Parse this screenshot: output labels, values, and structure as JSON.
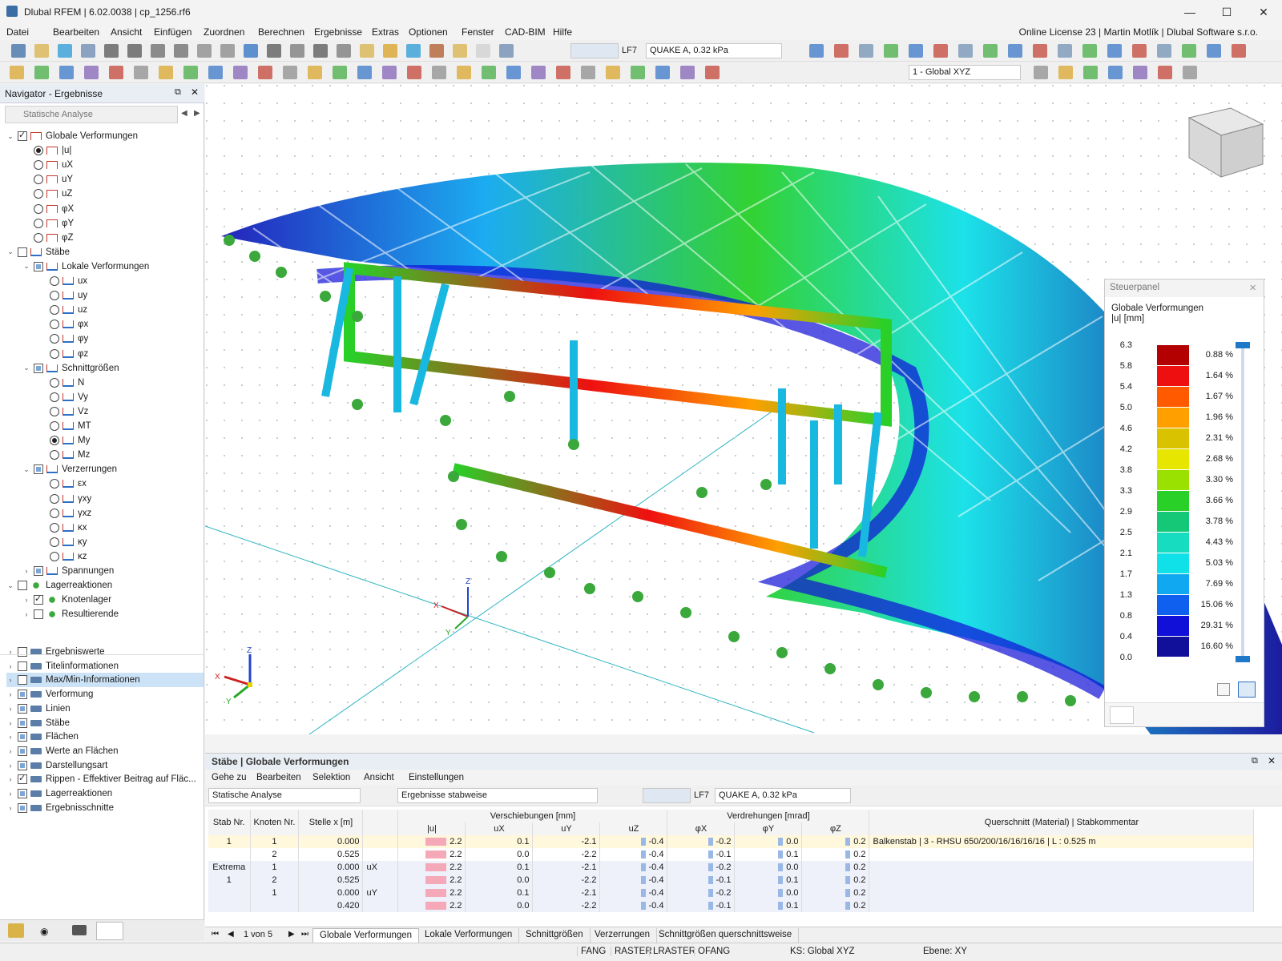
{
  "window": {
    "title": "Dlubal RFEM | 6.02.0038 | cp_1256.rf6",
    "license": "Online License 23 | Martin Motlík | Dlubal Software s.r.o."
  },
  "menu": [
    "Datei",
    "Bearbeiten",
    "Ansicht",
    "Einfügen",
    "Zuordnen",
    "Berechnen",
    "Ergebnisse",
    "Extras",
    "Optionen",
    "Fenster",
    "CAD-BIM",
    "Hilfe"
  ],
  "toolbar": {
    "load_case": "LF7",
    "load_case_name": "QUAKE A, 0.32 kPa",
    "coord_system": "1 - Global XYZ"
  },
  "navigator": {
    "title": "Navigator - Ergebnisse",
    "analysis": "Statische Analyse",
    "tree": [
      {
        "label": "Globale Verformungen",
        "type": "cb",
        "state": "on",
        "depth": 0,
        "exp": "v",
        "icon": "def"
      },
      {
        "label": "|u|",
        "type": "rb",
        "state": "on",
        "depth": 1,
        "icon": "def"
      },
      {
        "label": "uX",
        "type": "rb",
        "depth": 1,
        "icon": "def"
      },
      {
        "label": "uY",
        "type": "rb",
        "depth": 1,
        "icon": "def"
      },
      {
        "label": "uZ",
        "type": "rb",
        "depth": 1,
        "icon": "def"
      },
      {
        "label": "φX",
        "type": "rb",
        "depth": 1,
        "icon": "def"
      },
      {
        "label": "φY",
        "type": "rb",
        "depth": 1,
        "icon": "def"
      },
      {
        "label": "φZ",
        "type": "rb",
        "depth": 1,
        "icon": "def"
      },
      {
        "label": "Stäbe",
        "type": "cb",
        "depth": 0,
        "exp": "v",
        "icon": "mem"
      },
      {
        "label": "Lokale Verformungen",
        "type": "cb",
        "state": "part",
        "depth": 1,
        "exp": "v",
        "icon": "mem"
      },
      {
        "label": "ux",
        "type": "rb",
        "depth": 2,
        "icon": "mem"
      },
      {
        "label": "uy",
        "type": "rb",
        "depth": 2,
        "icon": "mem"
      },
      {
        "label": "uz",
        "type": "rb",
        "depth": 2,
        "icon": "mem"
      },
      {
        "label": "φx",
        "type": "rb",
        "depth": 2,
        "icon": "mem"
      },
      {
        "label": "φy",
        "type": "rb",
        "depth": 2,
        "icon": "mem"
      },
      {
        "label": "φz",
        "type": "rb",
        "depth": 2,
        "icon": "mem"
      },
      {
        "label": "Schnittgrößen",
        "type": "cb",
        "state": "part",
        "depth": 1,
        "exp": "v",
        "icon": "mem"
      },
      {
        "label": "N",
        "type": "rb",
        "depth": 2,
        "icon": "mem"
      },
      {
        "label": "Vy",
        "type": "rb",
        "depth": 2,
        "icon": "mem"
      },
      {
        "label": "Vz",
        "type": "rb",
        "depth": 2,
        "icon": "mem"
      },
      {
        "label": "MT",
        "type": "rb",
        "depth": 2,
        "icon": "mem"
      },
      {
        "label": "My",
        "type": "rb",
        "state": "on",
        "depth": 2,
        "icon": "mem"
      },
      {
        "label": "Mz",
        "type": "rb",
        "depth": 2,
        "icon": "mem"
      },
      {
        "label": "Verzerrungen",
        "type": "cb",
        "state": "part",
        "depth": 1,
        "exp": "v",
        "icon": "mem"
      },
      {
        "label": "εx",
        "type": "rb",
        "depth": 2,
        "icon": "mem"
      },
      {
        "label": "γxy",
        "type": "rb",
        "depth": 2,
        "icon": "mem"
      },
      {
        "label": "γxz",
        "type": "rb",
        "depth": 2,
        "icon": "mem"
      },
      {
        "label": "κx",
        "type": "rb",
        "depth": 2,
        "icon": "mem"
      },
      {
        "label": "κy",
        "type": "rb",
        "depth": 2,
        "icon": "mem"
      },
      {
        "label": "κz",
        "type": "rb",
        "depth": 2,
        "icon": "mem"
      },
      {
        "label": "Spannungen",
        "type": "cb",
        "state": "part",
        "depth": 1,
        "exp": ">",
        "icon": "mem"
      },
      {
        "label": "Lagerreaktionen",
        "type": "cb",
        "depth": 0,
        "exp": "v",
        "icon": "sup"
      },
      {
        "label": "Knotenlager",
        "type": "cb",
        "state": "on",
        "depth": 1,
        "exp": ">",
        "icon": "sup"
      },
      {
        "label": "Resultierende",
        "type": "cb",
        "depth": 1,
        "exp": ">",
        "icon": "sup"
      }
    ],
    "tree2": [
      {
        "label": "Ergebniswerte",
        "state": "",
        "icon": "gen"
      },
      {
        "label": "Titelinformationen",
        "state": "",
        "icon": "gen"
      },
      {
        "label": "Max/Min-Informationen",
        "state": "",
        "icon": "gen",
        "selected": true
      },
      {
        "label": "Verformung",
        "state": "part",
        "icon": "gen"
      },
      {
        "label": "Linien",
        "state": "part",
        "icon": "gen"
      },
      {
        "label": "Stäbe",
        "state": "part",
        "icon": "gen"
      },
      {
        "label": "Flächen",
        "state": "part",
        "icon": "gen"
      },
      {
        "label": "Werte an Flächen",
        "state": "part",
        "icon": "gen"
      },
      {
        "label": "Darstellungsart",
        "state": "part",
        "icon": "gen"
      },
      {
        "label": "Rippen - Effektiver Beitrag auf Fläc...",
        "state": "on",
        "icon": "gen"
      },
      {
        "label": "Lagerreaktionen",
        "state": "part",
        "icon": "gen"
      },
      {
        "label": "Ergebnisschnitte",
        "state": "part",
        "icon": "gen"
      }
    ]
  },
  "control_panel": {
    "title": "Steuerpanel",
    "subtitle": "Globale Verformungen",
    "unit": "|u| [mm]",
    "values": [
      "6.3",
      "5.8",
      "5.4",
      "5.0",
      "4.6",
      "4.2",
      "3.8",
      "3.3",
      "2.9",
      "2.5",
      "2.1",
      "1.7",
      "1.3",
      "0.8",
      "0.4",
      "0.0"
    ],
    "percents": [
      "0.88 %",
      "1.64 %",
      "1.67 %",
      "1.96 %",
      "2.31 %",
      "2.68 %",
      "3.30 %",
      "3.66 %",
      "3.78 %",
      "4.43 %",
      "5.03 %",
      "7.69 %",
      "15.06 %",
      "29.31 %",
      "16.60 %"
    ],
    "colors": [
      "#b30000",
      "#ee1010",
      "#ff5a00",
      "#ff9f00",
      "#d9c200",
      "#e6e600",
      "#9ae000",
      "#28d028",
      "#14c878",
      "#18dcc0",
      "#10e0e8",
      "#10a8f0",
      "#1060f0",
      "#1010d8",
      "#10109a"
    ]
  },
  "axes": {
    "x": "X",
    "y": "Y",
    "z": "Z"
  },
  "grid": {
    "title": "Stäbe | Globale Verformungen",
    "menu": [
      "Gehe zu",
      "Bearbeiten",
      "Selektion",
      "Ansicht",
      "Einstellungen"
    ],
    "analysis": "Statische Analyse",
    "mode": "Ergebnisse stabweise",
    "load_case": "LF7",
    "load_case_name": "QUAKE A, 0.32 kPa",
    "headers": {
      "stab": "Stab Nr.",
      "knoten": "Knoten Nr.",
      "stelle": "Stelle x [m]",
      "verschiebungen": "Verschiebungen [mm]",
      "verdrehungen": "Verdrehungen [mrad]",
      "u": "|u|",
      "ux": "uX",
      "uy": "uY",
      "uz": "uZ",
      "px": "φX",
      "py": "φY",
      "pz": "φZ",
      "qs": "Querschnitt (Material) | Stabkommentar"
    },
    "rows": [
      {
        "stab": "1",
        "knoten": "1",
        "x": "0.000",
        "t": "",
        "u": "2.2",
        "ux": "0.1",
        "uy": "-2.1",
        "uz": "-0.4",
        "px": "-0.2",
        "py": "0.0",
        "pz": "0.2",
        "qs": "Balkenstab | 3 - RHSU 650/200/16/16/16/16 | L : 0.525 m"
      },
      {
        "stab": "",
        "knoten": "2",
        "x": "0.525",
        "t": "",
        "u": "2.2",
        "ux": "0.0",
        "uy": "-2.2",
        "uz": "-0.4",
        "px": "-0.1",
        "py": "0.1",
        "pz": "0.2",
        "qs": ""
      },
      {
        "stab": "Extrema",
        "knoten": "1",
        "x": "0.000",
        "t": "uX",
        "u": "2.2",
        "ux": "0.1",
        "uy": "-2.1",
        "uz": "-0.4",
        "px": "-0.2",
        "py": "0.0",
        "pz": "0.2",
        "qs": ""
      },
      {
        "stab": "1",
        "knoten": "2",
        "x": "0.525",
        "t": "",
        "u": "2.2",
        "ux": "0.0",
        "uy": "-2.2",
        "uz": "-0.4",
        "px": "-0.1",
        "py": "0.1",
        "pz": "0.2",
        "qs": ""
      },
      {
        "stab": "",
        "knoten": "1",
        "x": "0.000",
        "t": "uY",
        "u": "2.2",
        "ux": "0.1",
        "uy": "-2.1",
        "uz": "-0.4",
        "px": "-0.2",
        "py": "0.0",
        "pz": "0.2",
        "qs": ""
      },
      {
        "stab": "",
        "knoten": "",
        "x": "0.420",
        "t": "",
        "u": "2.2",
        "ux": "0.0",
        "uy": "-2.2",
        "uz": "-0.4",
        "px": "-0.1",
        "py": "0.1",
        "pz": "0.2",
        "qs": ""
      }
    ],
    "pager": "1 von 5",
    "tabs": [
      "Globale Verformungen",
      "Lokale Verformungen",
      "Schnittgrößen",
      "Verzerrungen",
      "Schnittgrößen querschnittsweise"
    ]
  },
  "status": {
    "items": [
      "FANG",
      "RASTER",
      "LRASTER",
      "OFANG"
    ],
    "ks": "KS: Global XYZ",
    "ebene": "Ebene: XY"
  }
}
